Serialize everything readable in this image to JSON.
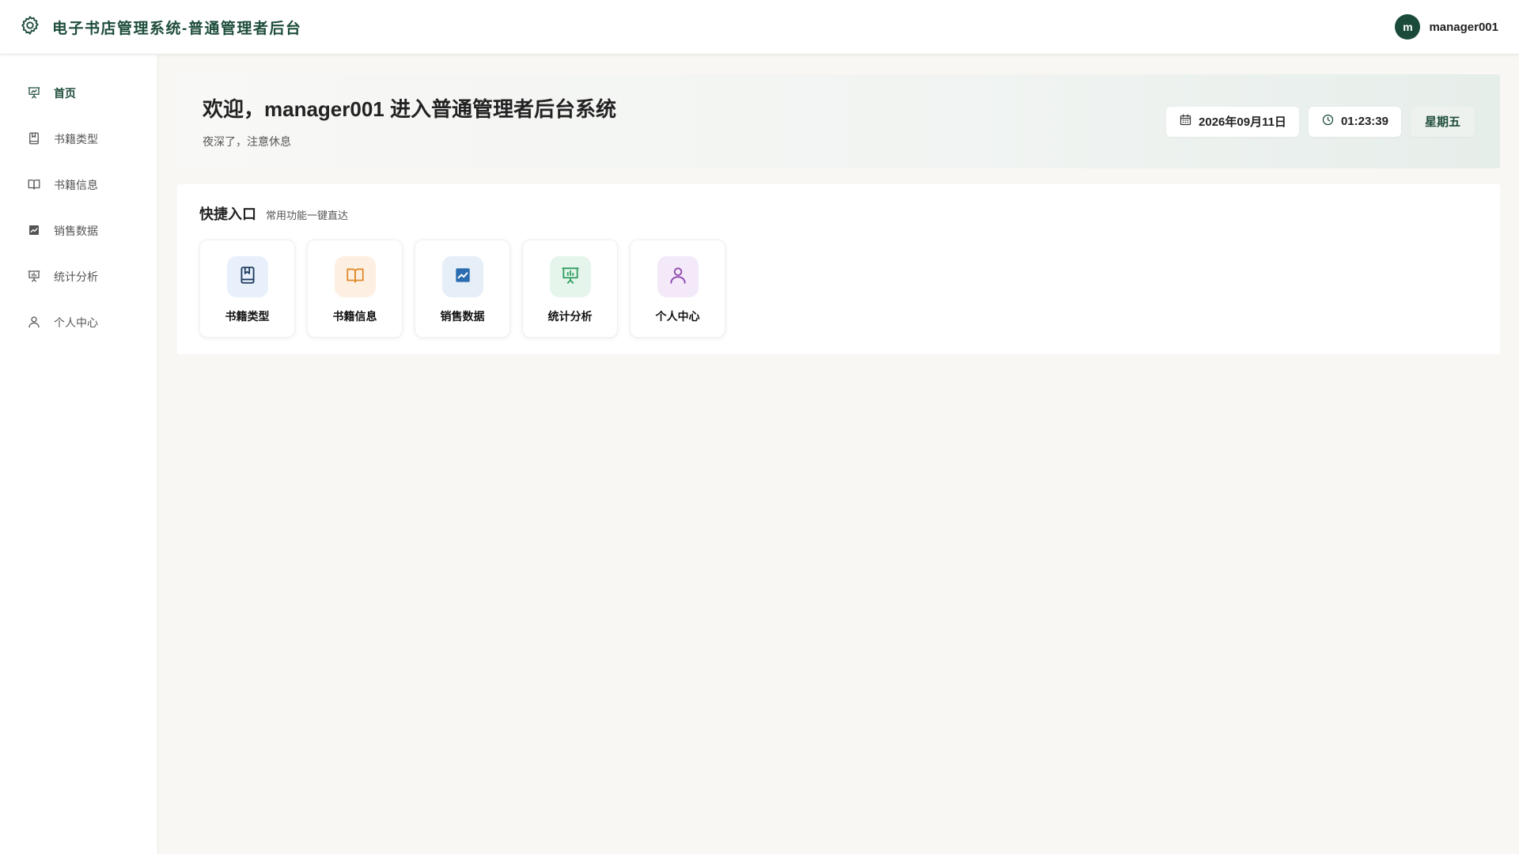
{
  "header": {
    "title": "电子书店管理系统-普通管理者后台",
    "logo_icon": "gear-icon",
    "user": {
      "avatar_letter": "m",
      "name": "manager001"
    },
    "brand_color": "#1e4d3b"
  },
  "sidebar": {
    "items": [
      {
        "label": "首页",
        "icon": "presentation-chart-icon",
        "active": true
      },
      {
        "label": "书籍类型",
        "icon": "bookmark-book-icon"
      },
      {
        "label": "书籍信息",
        "icon": "open-book-icon"
      },
      {
        "label": "销售数据",
        "icon": "line-chart-icon"
      },
      {
        "label": "统计分析",
        "icon": "presentation-chart-icon"
      },
      {
        "label": "个人中心",
        "icon": "user-icon"
      }
    ]
  },
  "welcome": {
    "title": "欢迎，manager001 进入普通管理者后台系统",
    "subtitle": "夜深了，注意休息",
    "date": "2026年09月11日",
    "time": "01:23:39",
    "weekday": "星期五"
  },
  "quick": {
    "title": "快捷入口",
    "subtitle": "常用功能一键直达",
    "cards": [
      {
        "label": "书籍类型",
        "icon": "bookmark-book-icon",
        "color": "#1e3a5f",
        "bg": "#e8f0fb"
      },
      {
        "label": "书籍信息",
        "icon": "open-book-icon",
        "color": "#e08a2c",
        "bg": "#fdf0e2"
      },
      {
        "label": "销售数据",
        "icon": "line-chart-icon",
        "color": "#2b6cb0",
        "bg": "#e6eef8"
      },
      {
        "label": "统计分析",
        "icon": "presentation-chart-icon",
        "color": "#2f9e5f",
        "bg": "#e5f5ec"
      },
      {
        "label": "个人中心",
        "icon": "user-icon",
        "color": "#8e44ad",
        "bg": "#f3e9f8"
      }
    ]
  }
}
